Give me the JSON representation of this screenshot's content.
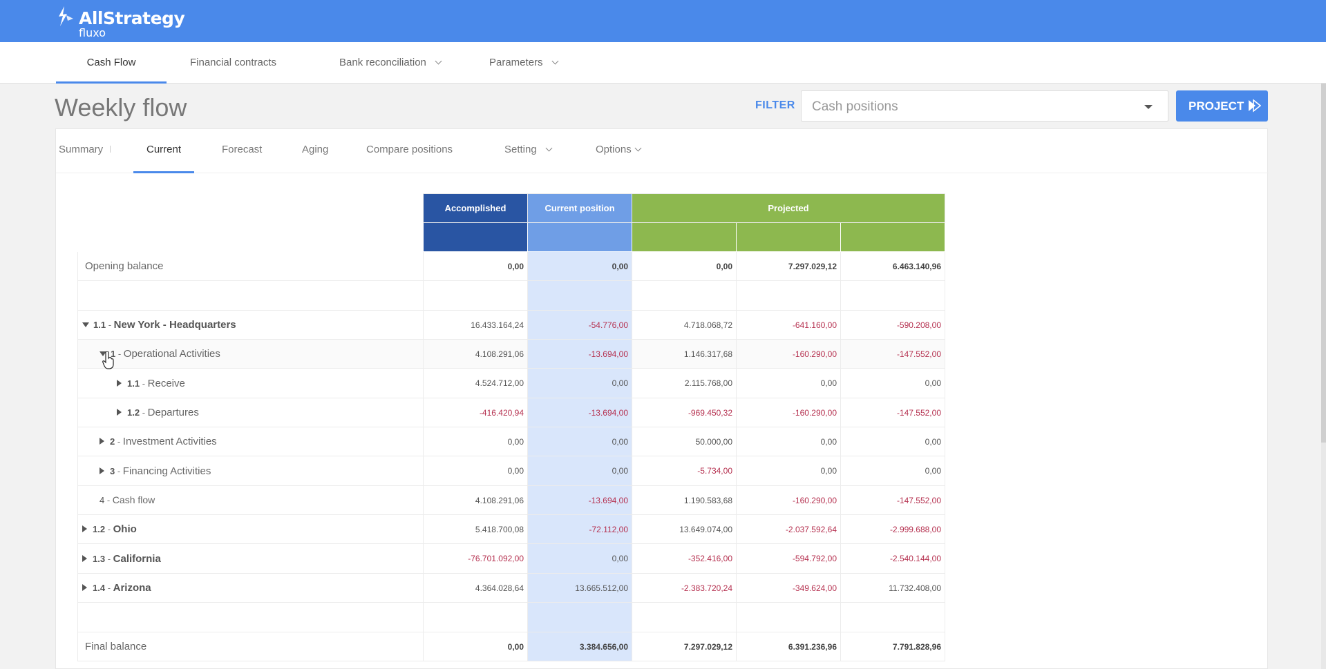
{
  "app": {
    "logo_title": "AllStrategy",
    "logo_sub": "fluxo"
  },
  "main_nav": [
    {
      "label": "Cash Flow",
      "active": true,
      "dropdown": false
    },
    {
      "label": "Financial contracts",
      "active": false,
      "dropdown": false
    },
    {
      "label": "Bank reconciliation",
      "active": false,
      "dropdown": true
    },
    {
      "label": "Parameters",
      "active": false,
      "dropdown": true
    }
  ],
  "page": {
    "title": "Weekly flow"
  },
  "filter": {
    "label": "FILTER",
    "placeholder": "Cash positions",
    "button": "PROJECT"
  },
  "sub_tabs": [
    {
      "label": "Summary",
      "active": false,
      "dropdown": false
    },
    {
      "label": "Current",
      "active": true,
      "dropdown": false
    },
    {
      "label": "Forecast",
      "active": false,
      "dropdown": false
    },
    {
      "label": "Aging",
      "active": false,
      "dropdown": false
    },
    {
      "label": "Compare positions",
      "active": false,
      "dropdown": false
    },
    {
      "label": "Setting",
      "active": false,
      "dropdown": true
    },
    {
      "label": "Options",
      "active": false,
      "dropdown": true
    }
  ],
  "table": {
    "headers": {
      "accomplished": "Accomplished",
      "current": "Current position",
      "projected": "Projected"
    },
    "rows": [
      {
        "kind": "plain",
        "label": "Opening balance",
        "values": [
          "0,00",
          "0,00",
          "0,00",
          "7.297.029,12",
          "6.463.140,96"
        ],
        "bold": true
      },
      {
        "kind": "blank"
      },
      {
        "kind": "group",
        "level": 1,
        "toggle": "open",
        "code": "1.1",
        "name": "New York - Headquarters",
        "values": [
          "16.433.164,24",
          "-54.776,00",
          "4.718.068,72",
          "-641.160,00",
          "-590.208,00"
        ]
      },
      {
        "kind": "group",
        "level": 2,
        "toggle": "open",
        "code": "1",
        "name": "Operational Activities",
        "values": [
          "4.108.291,06",
          "-13.694,00",
          "1.146.317,68",
          "-160.290,00",
          "-147.552,00"
        ],
        "shade": true
      },
      {
        "kind": "group",
        "level": 3,
        "toggle": "closed",
        "code": "1.1",
        "name": "Receive",
        "values": [
          "4.524.712,00",
          "0,00",
          "2.115.768,00",
          "0,00",
          "0,00"
        ]
      },
      {
        "kind": "group",
        "level": 3,
        "toggle": "closed",
        "code": "1.2",
        "name": "Departures",
        "values": [
          "-416.420,94",
          "-13.694,00",
          "-969.450,32",
          "-160.290,00",
          "-147.552,00"
        ]
      },
      {
        "kind": "group",
        "level": 2,
        "toggle": "closed",
        "code": "2",
        "name": "Investment Activities",
        "values": [
          "0,00",
          "0,00",
          "50.000,00",
          "0,00",
          "0,00"
        ]
      },
      {
        "kind": "group",
        "level": 2,
        "toggle": "closed",
        "code": "3",
        "name": "Financing Activities",
        "values": [
          "0,00",
          "0,00",
          "-5.734,00",
          "0,00",
          "0,00"
        ]
      },
      {
        "kind": "group",
        "level": 2,
        "toggle": "none",
        "code": "4",
        "name": "Cash flow",
        "values": [
          "4.108.291,06",
          "-13.694,00",
          "1.190.583,68",
          "-160.290,00",
          "-147.552,00"
        ]
      },
      {
        "kind": "group",
        "level": 1,
        "toggle": "closed",
        "code": "1.2",
        "name": "Ohio",
        "values": [
          "5.418.700,08",
          "-72.112,00",
          "13.649.074,00",
          "-2.037.592,64",
          "-2.999.688,00"
        ]
      },
      {
        "kind": "group",
        "level": 1,
        "toggle": "closed",
        "code": "1.3",
        "name": "California",
        "values": [
          "-76.701.092,00",
          "0,00",
          "-352.416,00",
          "-594.792,00",
          "-2.540.144,00"
        ]
      },
      {
        "kind": "group",
        "level": 1,
        "toggle": "closed",
        "code": "1.4",
        "name": "Arizona",
        "values": [
          "4.364.028,64",
          "13.665.512,00",
          "-2.383.720,24",
          "-349.624,00",
          "11.732.408,00"
        ]
      },
      {
        "kind": "blank"
      },
      {
        "kind": "plain",
        "label": "Final balance",
        "values": [
          "0,00",
          "3.384.656,00",
          "7.297.029,12",
          "6.391.236,96",
          "7.791.828,96"
        ],
        "bold": true
      }
    ]
  },
  "colors": {
    "brand": "#4a89ea",
    "accomplished": "#2955a3",
    "current": "#6f9ee6",
    "projected": "#8db84f",
    "negative": "#b5304f"
  }
}
